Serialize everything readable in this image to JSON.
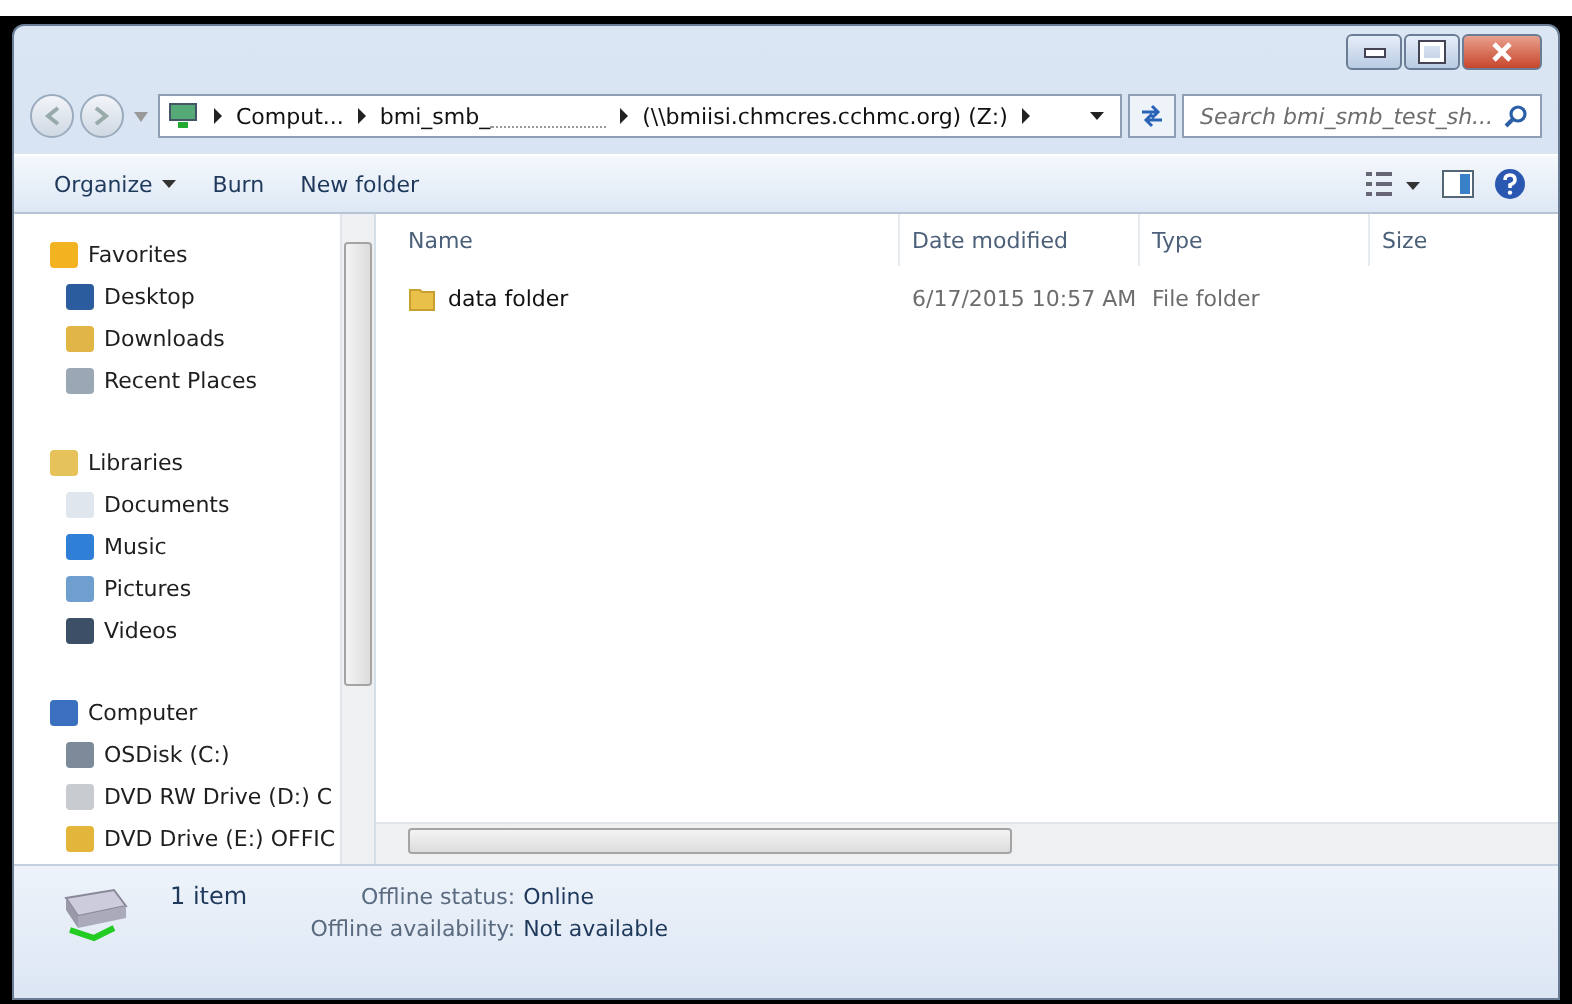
{
  "address": {
    "segments": [
      {
        "text": "Comput..."
      },
      {
        "text": "bmi_smb_",
        "redacted": true
      },
      {
        "text": "(\\\\bmiisi.chmcres.cchmc.org) (Z:)"
      }
    ]
  },
  "search": {
    "placeholder": "Search bmi_smb_test_sh..."
  },
  "toolbar": {
    "buttons": [
      {
        "label": "Organize",
        "dropdown": true
      },
      {
        "label": "Burn",
        "dropdown": false
      },
      {
        "label": "New folder",
        "dropdown": false
      }
    ]
  },
  "sidebar": {
    "groups": [
      {
        "label": "Favorites",
        "kind": "star",
        "children": [
          {
            "label": "Desktop",
            "kind": "desktop"
          },
          {
            "label": "Downloads",
            "kind": "downloads"
          },
          {
            "label": "Recent Places",
            "kind": "recent"
          }
        ]
      },
      {
        "label": "Libraries",
        "kind": "libraries",
        "children": [
          {
            "label": "Documents",
            "kind": "documents"
          },
          {
            "label": "Music",
            "kind": "music"
          },
          {
            "label": "Pictures",
            "kind": "pictures"
          },
          {
            "label": "Videos",
            "kind": "videos"
          }
        ]
      },
      {
        "label": "Computer",
        "kind": "computer",
        "children": [
          {
            "label": "OSDisk (C:)",
            "kind": "disk"
          },
          {
            "label": "DVD RW Drive (D:) C",
            "kind": "dvd"
          },
          {
            "label": "DVD Drive (E:) OFFIC",
            "kind": "dvdapp"
          }
        ]
      }
    ]
  },
  "table": {
    "columns": [
      "Name",
      "Date modified",
      "Type",
      "Size"
    ],
    "rows": [
      {
        "name": "data folder",
        "date_modified": "6/17/2015 10:57 AM",
        "type": "File folder"
      }
    ]
  },
  "status_bar": {
    "count": "1 item",
    "fields": [
      {
        "label": "Offline status:",
        "value": "Online"
      },
      {
        "label": "Offline availability:",
        "value": "Not available"
      }
    ]
  }
}
